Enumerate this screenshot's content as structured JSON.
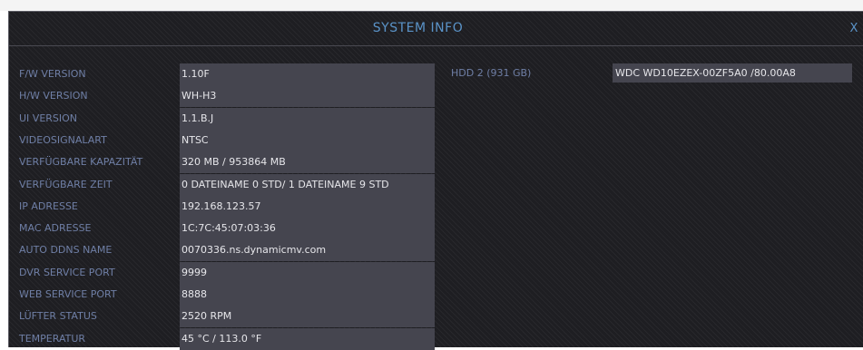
{
  "dialog": {
    "title": "SYSTEM INFO",
    "close_label": "X"
  },
  "info_rows": [
    {
      "label": "F/W VERSION",
      "value": "1.10F"
    },
    {
      "label": "H/W VERSION",
      "value": "WH-H3"
    },
    {
      "label": "UI VERSION",
      "value": "1.1.B.J"
    },
    {
      "label": "VIDEOSIGNALART",
      "value": "NTSC"
    },
    {
      "label": "VERFÜGBARE KAPAZITÄT",
      "value": "320 MB  /  953864 MB"
    },
    {
      "label": "VERFÜGBARE ZEIT",
      "value": "0 DATEINAME 0 STD/  1 DATEINAME 9 STD"
    },
    {
      "label": "IP ADRESSE",
      "value": "192.168.123.57"
    },
    {
      "label": "MAC ADRESSE",
      "value": "1C:7C:45:07:03:36"
    },
    {
      "label": "AUTO DDNS NAME",
      "value": "0070336.ns.dynamicmv.com"
    },
    {
      "label": "DVR SERVICE PORT",
      "value": "9999"
    },
    {
      "label": "WEB SERVICE PORT",
      "value": "8888"
    },
    {
      "label": "LÜFTER STATUS",
      "value": "2520 RPM"
    },
    {
      "label": "TEMPERATUR",
      "value": "45 °C  /  113.0 °F"
    }
  ],
  "hdd": {
    "label": "HDD 2 (931 GB)",
    "value": "WDC WD10EZEX-00ZF5A0  /80.00A8"
  },
  "colors": {
    "title": "#5a93c8",
    "label": "#6f7fa6",
    "value_bg": "#45454f",
    "value_text": "#e6e6ea",
    "dialog_bg": "#1e1e22"
  }
}
